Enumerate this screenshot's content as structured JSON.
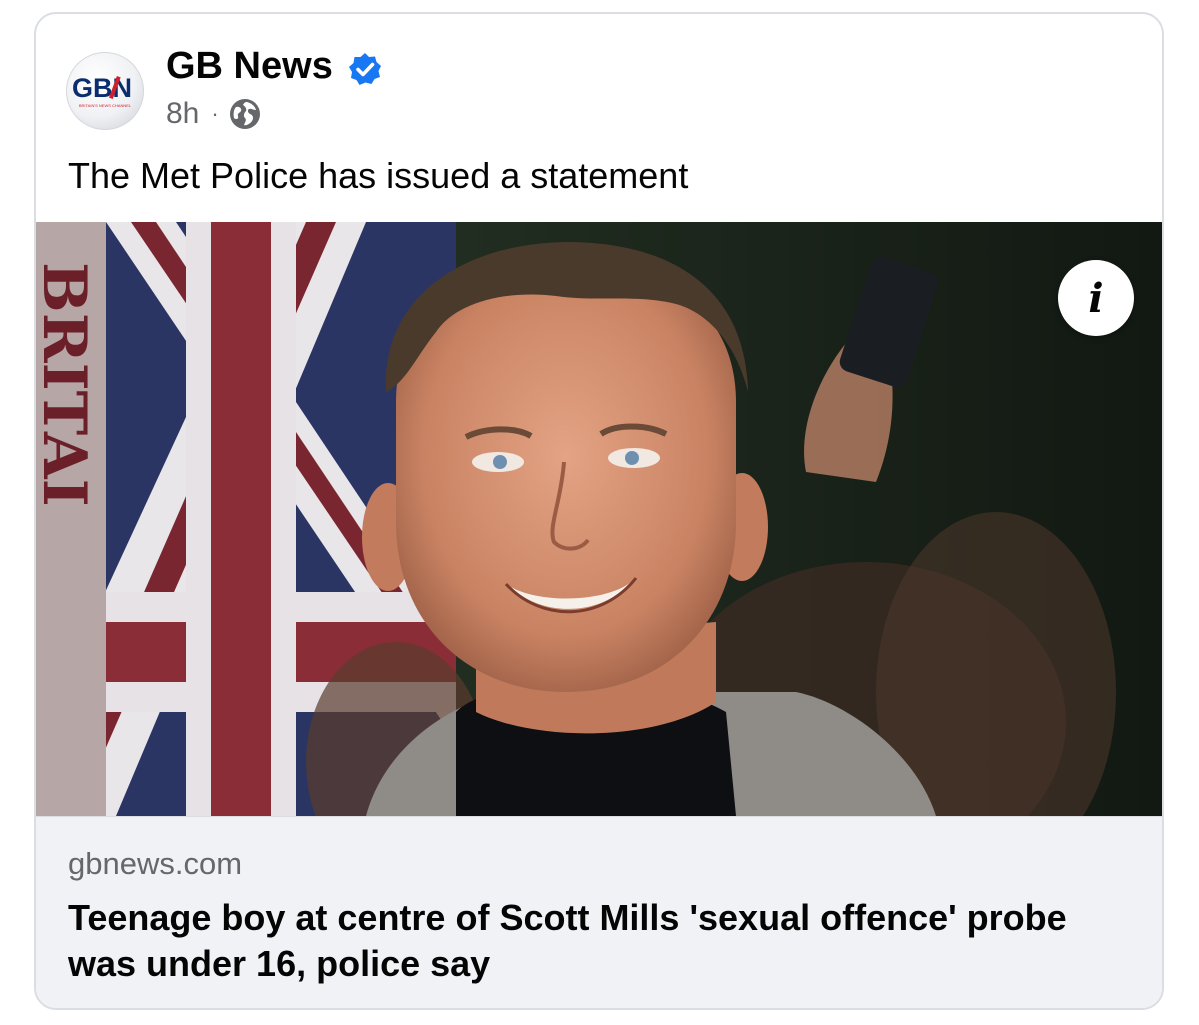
{
  "post": {
    "author_name": "GB News",
    "timestamp": "8h",
    "separator": "·",
    "audience_icon": "globe-icon",
    "verified_icon": "verified-badge-icon",
    "text": "The Met Police has issued a statement",
    "logo": {
      "text": "GBN",
      "tagline": "BRITAIN'S NEWS CHANNEL"
    }
  },
  "media": {
    "info_icon_glyph": "i",
    "backdrop_letters": "BRITAI"
  },
  "link": {
    "domain": "gbnews.com",
    "title": "Teenage boy at centre of Scott Mills 'sexual offence' probe was under 16, police say"
  },
  "colors": {
    "verified": "#1877f2",
    "secondary_text": "#65676b",
    "primary_text": "#050505",
    "link_bg": "#f0f2f5"
  }
}
